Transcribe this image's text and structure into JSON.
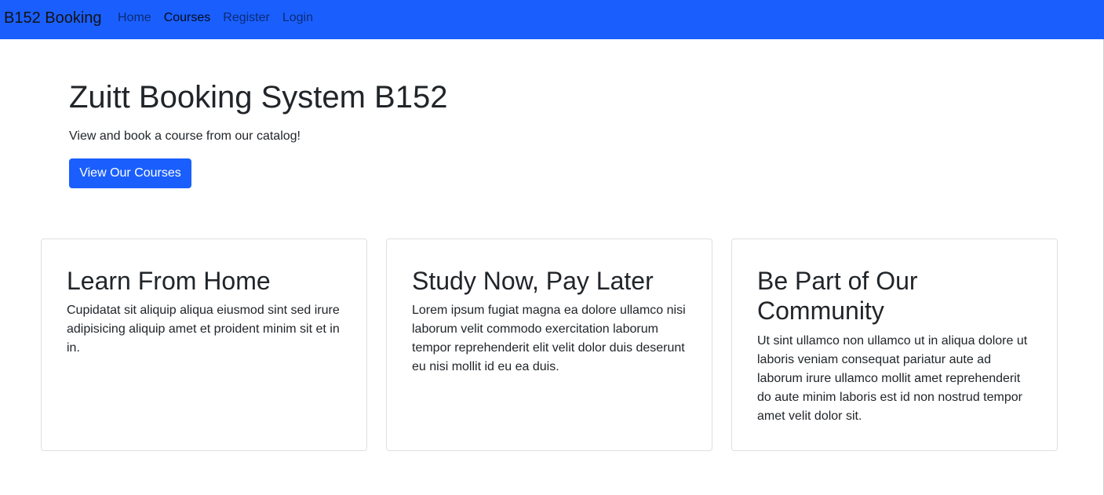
{
  "navbar": {
    "brand": "B152 Booking",
    "links": [
      {
        "label": "Home",
        "active": false
      },
      {
        "label": "Courses",
        "active": true
      },
      {
        "label": "Register",
        "active": false
      },
      {
        "label": "Login",
        "active": false
      }
    ]
  },
  "banner": {
    "title": "Zuitt Booking System B152",
    "subtitle": "View and book a course from our catalog!",
    "cta_label": "View Our Courses"
  },
  "highlights": [
    {
      "title": "Learn From Home",
      "text": "Cupidatat sit aliquip aliqua eiusmod sint sed irure adipisicing aliquip amet et proident minim sit et in in."
    },
    {
      "title": "Study Now, Pay Later",
      "text": "Lorem ipsum fugiat magna ea dolore ullamco nisi laborum velit commodo exercitation laborum tempor reprehenderit elit velit dolor duis deserunt eu nisi mollit id eu ea duis."
    },
    {
      "title": "Be Part of Our Community",
      "text": "Ut sint ullamco non ullamco ut in aliqua dolore ut laboris veniam consequat pariatur aute ad laborum irure ullamco mollit amet reprehenderit do aute minim laboris est id non nostrud tempor amet velit dolor sit."
    }
  ],
  "colors": {
    "navbar_bg": "#1a5ffe",
    "button_bg": "#1a5ffe",
    "text": "#212529"
  }
}
